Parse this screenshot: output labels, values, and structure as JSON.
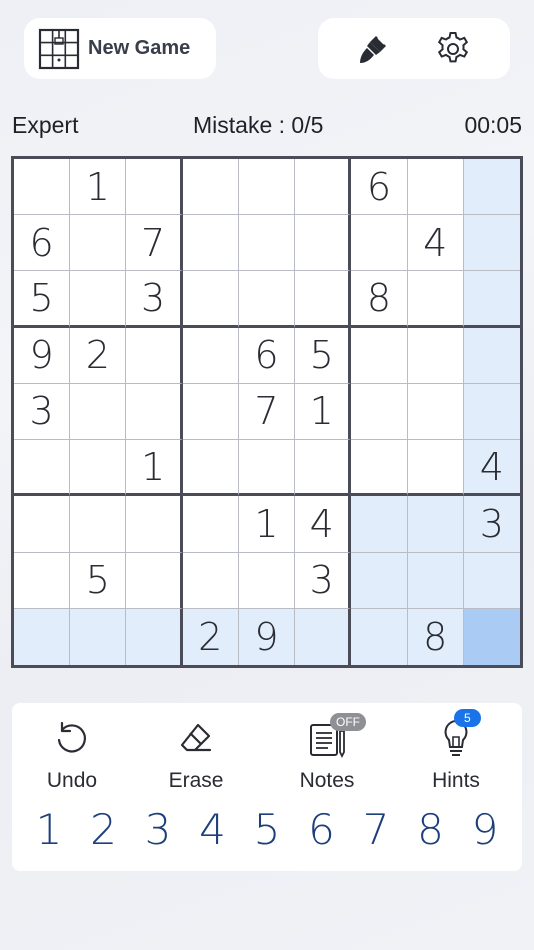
{
  "header": {
    "new_game_label": "New Game",
    "icons": [
      "grid-icon",
      "paintbrush-icon",
      "gear-icon"
    ]
  },
  "status": {
    "difficulty": "Expert",
    "mistakes": "Mistake : 0/5",
    "timer": "00:05"
  },
  "board": {
    "rows": [
      [
        "",
        "1",
        "",
        "",
        "",
        "",
        "6",
        "",
        ""
      ],
      [
        "6",
        "",
        "7",
        "",
        "",
        "",
        "",
        "4",
        ""
      ],
      [
        "5",
        "",
        "3",
        "",
        "",
        "",
        "8",
        "",
        ""
      ],
      [
        "9",
        "2",
        "",
        "",
        "6",
        "5",
        "",
        "",
        ""
      ],
      [
        "3",
        "",
        "",
        "",
        "7",
        "1",
        "",
        "",
        ""
      ],
      [
        "",
        "",
        "1",
        "",
        "",
        "",
        "",
        "",
        "4"
      ],
      [
        "",
        "",
        "",
        "",
        "1",
        "4",
        "",
        "",
        "3"
      ],
      [
        "",
        "5",
        "",
        "",
        "",
        "3",
        "",
        "",
        ""
      ],
      [
        "",
        "",
        "",
        "2",
        "9",
        "",
        "",
        "8",
        ""
      ]
    ],
    "selected_cell": [
      8,
      8
    ],
    "highlight_color": "#e2edfc",
    "selected_color": "#a9cbf4"
  },
  "controls": {
    "undo_label": "Undo",
    "erase_label": "Erase",
    "notes_label": "Notes",
    "notes_badge": "OFF",
    "hints_label": "Hints",
    "hints_badge": "5"
  },
  "numpad": [
    "1",
    "2",
    "3",
    "4",
    "5",
    "6",
    "7",
    "8",
    "9"
  ]
}
